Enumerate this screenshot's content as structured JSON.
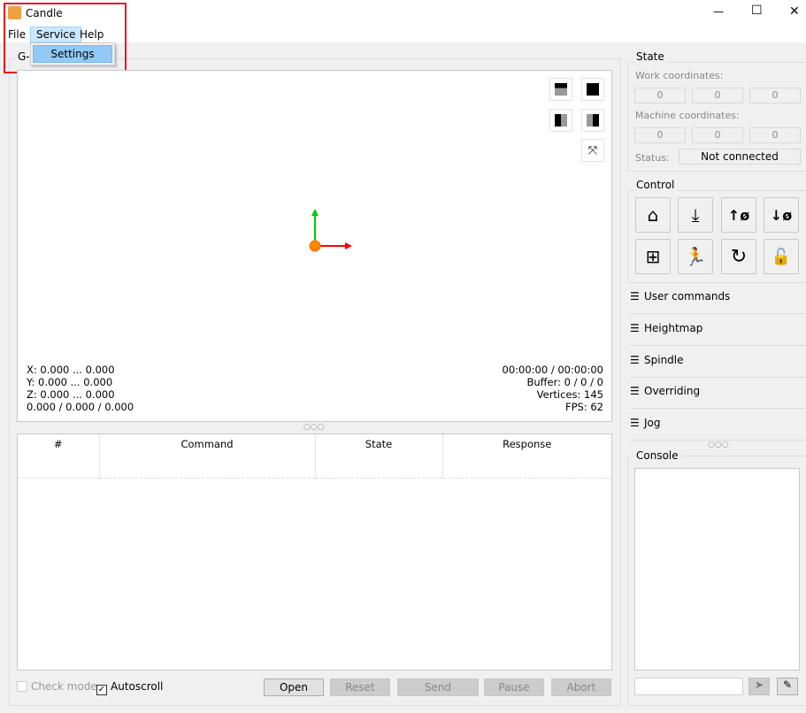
{
  "window": {
    "title": "Candle",
    "minimize": "—",
    "maximize": "☐",
    "close": "✕"
  },
  "menu": {
    "items": [
      "File",
      "Service",
      "Help"
    ],
    "dropdown": [
      "Settings"
    ]
  },
  "gcode_group": {
    "title": "G-code"
  },
  "viewport": {
    "coords": [
      "X: 0.000 ... 0.000",
      "Y: 0.000 ... 0.000",
      "Z: 0.000 ... 0.000",
      "0.000 / 0.000 / 0.000"
    ],
    "stats": [
      "00:00:00 / 00:00:00",
      "Buffer: 0 / 0 / 0",
      "Vertices: 145",
      "FPS: 62"
    ]
  },
  "table": {
    "headers": [
      "#",
      "Command",
      "State",
      "Response"
    ]
  },
  "bottom": {
    "check_mode": "Check mode",
    "autoscroll": "Autoscroll",
    "open": "Open",
    "reset": "Reset",
    "send": "Send",
    "pause": "Pause",
    "abort": "Abort"
  },
  "state": {
    "title": "State",
    "work_label": "Work coordinates:",
    "work": [
      "0",
      "0",
      "0"
    ],
    "machine_label": "Machine coordinates:",
    "machine": [
      "0",
      "0",
      "0"
    ],
    "status_label": "Status:",
    "status": "Not connected"
  },
  "control": {
    "title": "Control"
  },
  "sections": [
    "User commands",
    "Heightmap",
    "Spindle",
    "Overriding",
    "Jog"
  ],
  "console": {
    "title": "Console"
  },
  "colors": {
    "accent": "#99c9ef",
    "highlight_border": "#e81123"
  }
}
